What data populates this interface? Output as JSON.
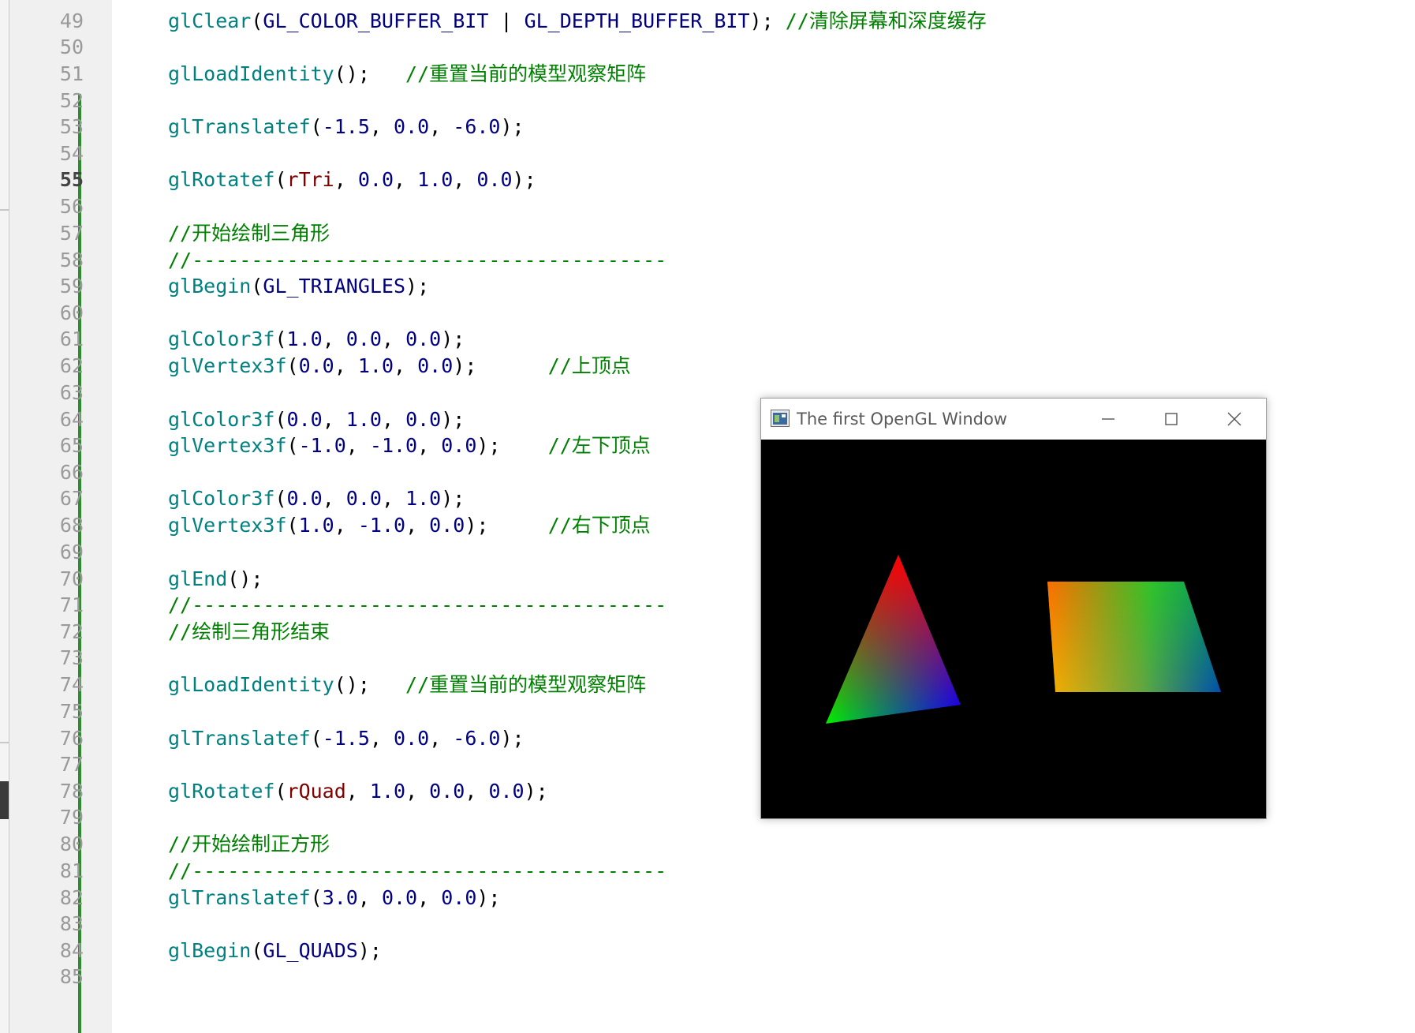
{
  "editor": {
    "active_line": "55",
    "lines": [
      {
        "n": "49",
        "tokens": [
          [
            "fn",
            "glClear"
          ],
          [
            "pun",
            "("
          ],
          [
            "cst",
            "GL_COLOR_BUFFER_BIT"
          ],
          [
            "pun",
            " | "
          ],
          [
            "cst",
            "GL_DEPTH_BUFFER_BIT"
          ],
          [
            "pun",
            "); "
          ],
          [
            "cmt",
            "//清除屏幕和深度缓存"
          ]
        ]
      },
      {
        "n": "50",
        "tokens": []
      },
      {
        "n": "51",
        "tokens": [
          [
            "fn",
            "glLoadIdentity"
          ],
          [
            "pun",
            "();   "
          ],
          [
            "cmt",
            "//重置当前的模型观察矩阵"
          ]
        ]
      },
      {
        "n": "52",
        "tokens": []
      },
      {
        "n": "53",
        "tokens": [
          [
            "fn",
            "glTranslatef"
          ],
          [
            "pun",
            "("
          ],
          [
            "num",
            "-1.5"
          ],
          [
            "pun",
            ", "
          ],
          [
            "num",
            "0.0"
          ],
          [
            "pun",
            ", "
          ],
          [
            "num",
            "-6.0"
          ],
          [
            "pun",
            ");"
          ]
        ]
      },
      {
        "n": "54",
        "tokens": []
      },
      {
        "n": "55",
        "tokens": [
          [
            "fn",
            "glRotatef"
          ],
          [
            "pun",
            "("
          ],
          [
            "var",
            "rTri"
          ],
          [
            "pun",
            ", "
          ],
          [
            "num",
            "0.0"
          ],
          [
            "pun",
            ", "
          ],
          [
            "num",
            "1.0"
          ],
          [
            "pun",
            ", "
          ],
          [
            "num",
            "0.0"
          ],
          [
            "pun",
            ");"
          ]
        ]
      },
      {
        "n": "56",
        "tokens": []
      },
      {
        "n": "57",
        "tokens": [
          [
            "cmt",
            "//开始绘制三角形"
          ]
        ]
      },
      {
        "n": "58",
        "tokens": [
          [
            "cmt",
            "//----------------------------------------"
          ]
        ]
      },
      {
        "n": "59",
        "tokens": [
          [
            "fn",
            "glBegin"
          ],
          [
            "pun",
            "("
          ],
          [
            "cst",
            "GL_TRIANGLES"
          ],
          [
            "pun",
            ");"
          ]
        ]
      },
      {
        "n": "60",
        "tokens": []
      },
      {
        "n": "61",
        "tokens": [
          [
            "fn",
            "glColor3f"
          ],
          [
            "pun",
            "("
          ],
          [
            "num",
            "1.0"
          ],
          [
            "pun",
            ", "
          ],
          [
            "num",
            "0.0"
          ],
          [
            "pun",
            ", "
          ],
          [
            "num",
            "0.0"
          ],
          [
            "pun",
            ");"
          ]
        ]
      },
      {
        "n": "62",
        "tokens": [
          [
            "fn",
            "glVertex3f"
          ],
          [
            "pun",
            "("
          ],
          [
            "num",
            "0.0"
          ],
          [
            "pun",
            ", "
          ],
          [
            "num",
            "1.0"
          ],
          [
            "pun",
            ", "
          ],
          [
            "num",
            "0.0"
          ],
          [
            "pun",
            ");      "
          ],
          [
            "cmt",
            "//上顶点"
          ]
        ]
      },
      {
        "n": "63",
        "tokens": []
      },
      {
        "n": "64",
        "tokens": [
          [
            "fn",
            "glColor3f"
          ],
          [
            "pun",
            "("
          ],
          [
            "num",
            "0.0"
          ],
          [
            "pun",
            ", "
          ],
          [
            "num",
            "1.0"
          ],
          [
            "pun",
            ", "
          ],
          [
            "num",
            "0.0"
          ],
          [
            "pun",
            ");"
          ]
        ]
      },
      {
        "n": "65",
        "tokens": [
          [
            "fn",
            "glVertex3f"
          ],
          [
            "pun",
            "("
          ],
          [
            "num",
            "-1.0"
          ],
          [
            "pun",
            ", "
          ],
          [
            "num",
            "-1.0"
          ],
          [
            "pun",
            ", "
          ],
          [
            "num",
            "0.0"
          ],
          [
            "pun",
            ");    "
          ],
          [
            "cmt",
            "//左下顶点"
          ]
        ]
      },
      {
        "n": "66",
        "tokens": []
      },
      {
        "n": "67",
        "tokens": [
          [
            "fn",
            "glColor3f"
          ],
          [
            "pun",
            "("
          ],
          [
            "num",
            "0.0"
          ],
          [
            "pun",
            ", "
          ],
          [
            "num",
            "0.0"
          ],
          [
            "pun",
            ", "
          ],
          [
            "num",
            "1.0"
          ],
          [
            "pun",
            ");"
          ]
        ]
      },
      {
        "n": "68",
        "tokens": [
          [
            "fn",
            "glVertex3f"
          ],
          [
            "pun",
            "("
          ],
          [
            "num",
            "1.0"
          ],
          [
            "pun",
            ", "
          ],
          [
            "num",
            "-1.0"
          ],
          [
            "pun",
            ", "
          ],
          [
            "num",
            "0.0"
          ],
          [
            "pun",
            ");     "
          ],
          [
            "cmt",
            "//右下顶点"
          ]
        ]
      },
      {
        "n": "69",
        "tokens": []
      },
      {
        "n": "70",
        "tokens": [
          [
            "fn",
            "glEnd"
          ],
          [
            "pun",
            "();"
          ]
        ]
      },
      {
        "n": "71",
        "tokens": [
          [
            "cmt",
            "//----------------------------------------"
          ]
        ]
      },
      {
        "n": "72",
        "tokens": [
          [
            "cmt",
            "//绘制三角形结束"
          ]
        ]
      },
      {
        "n": "73",
        "tokens": []
      },
      {
        "n": "74",
        "tokens": [
          [
            "fn",
            "glLoadIdentity"
          ],
          [
            "pun",
            "();   "
          ],
          [
            "cmt",
            "//重置当前的模型观察矩阵"
          ]
        ]
      },
      {
        "n": "75",
        "tokens": []
      },
      {
        "n": "76",
        "tokens": [
          [
            "fn",
            "glTranslatef"
          ],
          [
            "pun",
            "("
          ],
          [
            "num",
            "-1.5"
          ],
          [
            "pun",
            ", "
          ],
          [
            "num",
            "0.0"
          ],
          [
            "pun",
            ", "
          ],
          [
            "num",
            "-6.0"
          ],
          [
            "pun",
            ");"
          ]
        ]
      },
      {
        "n": "77",
        "tokens": []
      },
      {
        "n": "78",
        "tokens": [
          [
            "fn",
            "glRotatef"
          ],
          [
            "pun",
            "("
          ],
          [
            "var",
            "rQuad"
          ],
          [
            "pun",
            ", "
          ],
          [
            "num",
            "1.0"
          ],
          [
            "pun",
            ", "
          ],
          [
            "num",
            "0.0"
          ],
          [
            "pun",
            ", "
          ],
          [
            "num",
            "0.0"
          ],
          [
            "pun",
            ");"
          ]
        ]
      },
      {
        "n": "79",
        "tokens": []
      },
      {
        "n": "80",
        "tokens": [
          [
            "cmt",
            "//开始绘制正方形"
          ]
        ]
      },
      {
        "n": "81",
        "tokens": [
          [
            "cmt",
            "//----------------------------------------"
          ]
        ]
      },
      {
        "n": "82",
        "tokens": [
          [
            "fn",
            "glTranslatef"
          ],
          [
            "pun",
            "("
          ],
          [
            "num",
            "3.0"
          ],
          [
            "pun",
            ", "
          ],
          [
            "num",
            "0.0"
          ],
          [
            "pun",
            ", "
          ],
          [
            "num",
            "0.0"
          ],
          [
            "pun",
            ");"
          ]
        ]
      },
      {
        "n": "83",
        "tokens": []
      },
      {
        "n": "84",
        "tokens": [
          [
            "fn",
            "glBegin"
          ],
          [
            "pun",
            "("
          ],
          [
            "cst",
            "GL_QUADS"
          ],
          [
            "pun",
            ");"
          ]
        ]
      },
      {
        "n": "85",
        "tokens": []
      }
    ]
  },
  "gl_window": {
    "title": "The first OpenGL Window",
    "minimize_icon": "minimize-icon",
    "maximize_icon": "maximize-icon",
    "close_icon": "close-icon",
    "app_icon": "opengl-app-icon",
    "canvas_background": "#000000"
  },
  "colors": {
    "comment": "#008000",
    "function": "#008080",
    "constant": "#000080",
    "variable": "#800000",
    "change_bar": "#2e8b2e"
  }
}
